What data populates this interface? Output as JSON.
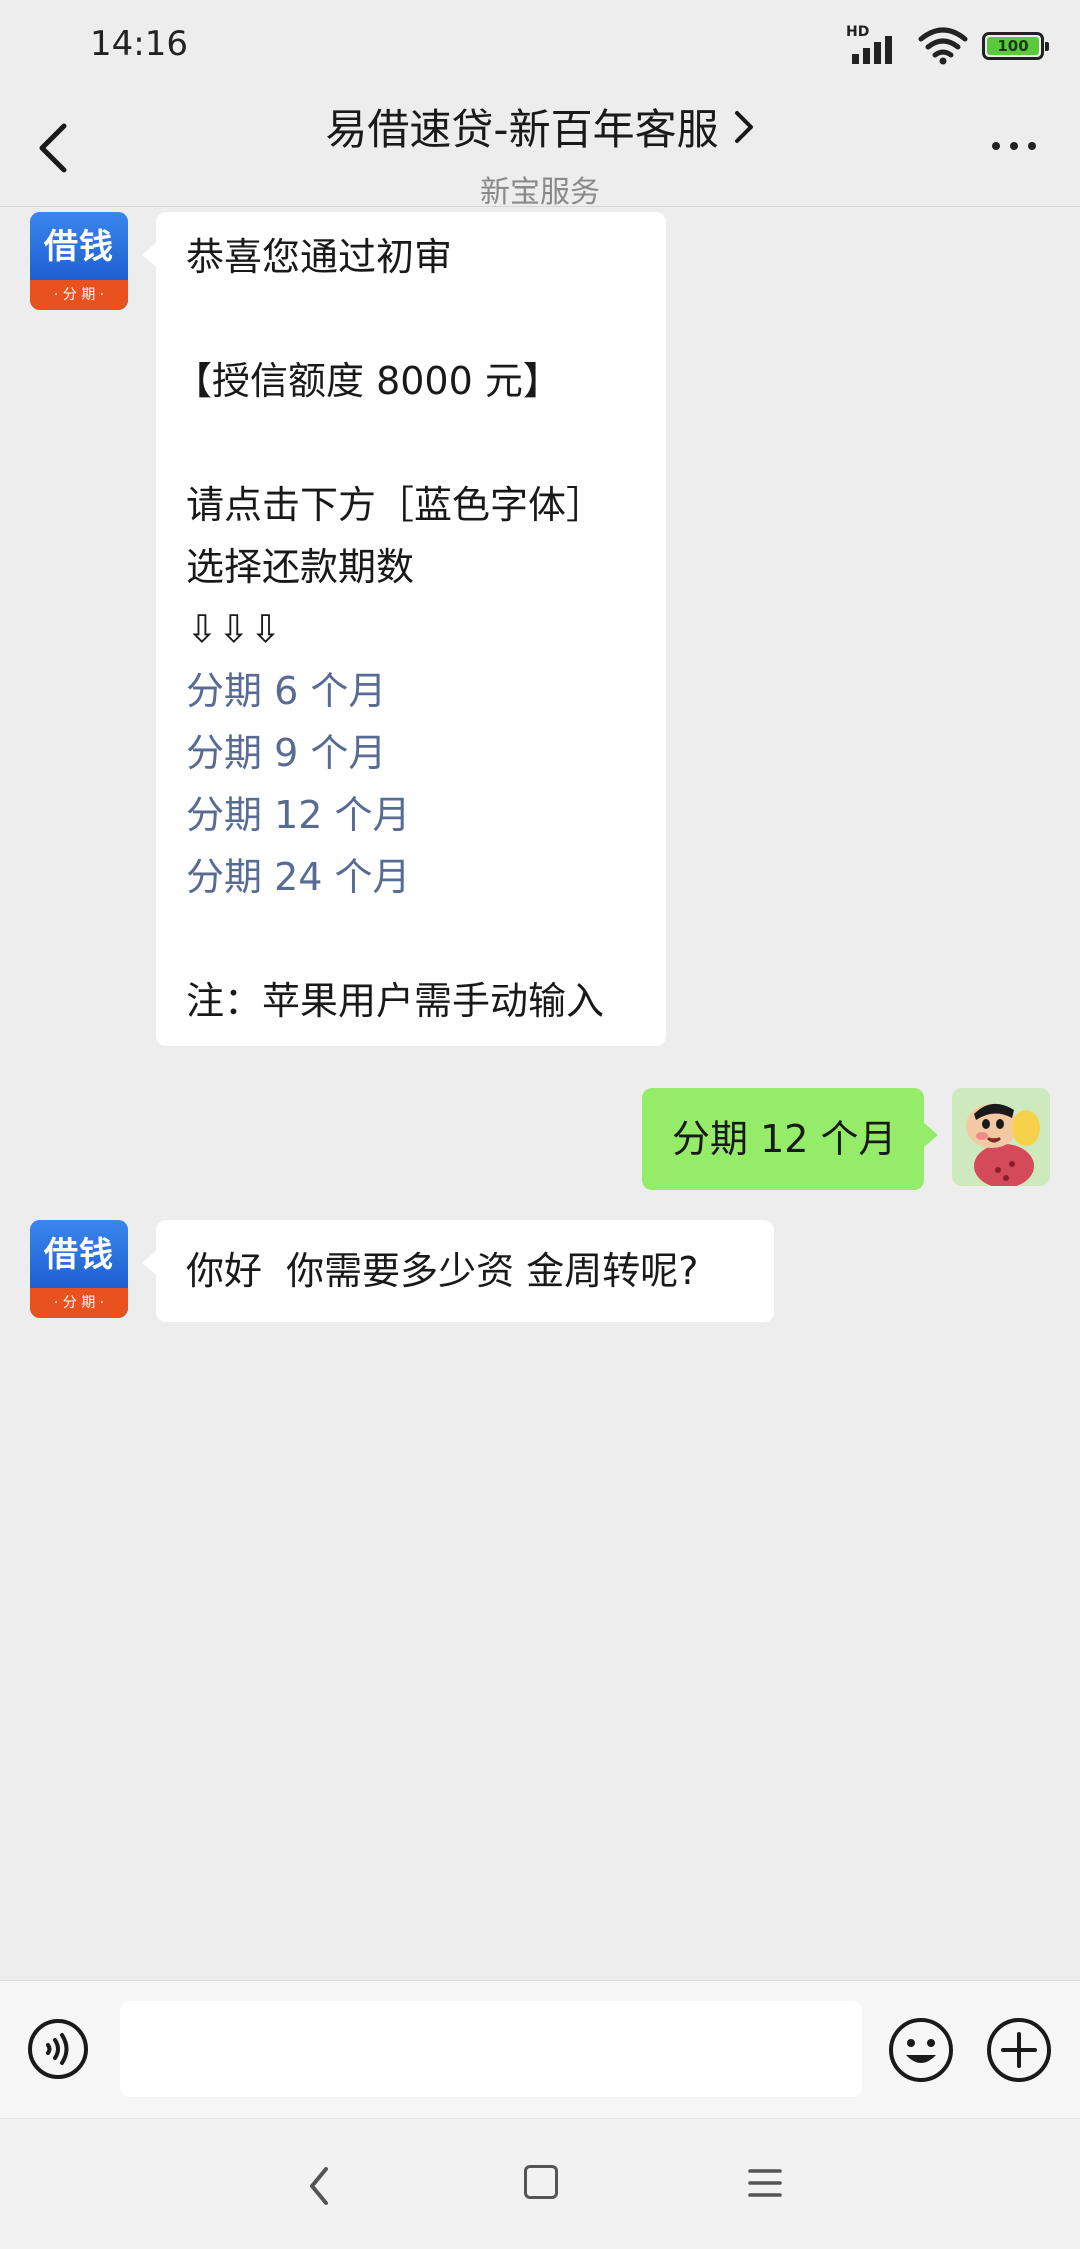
{
  "status_bar": {
    "time": "14:16",
    "network_label": "HD",
    "battery_level": "100",
    "icons": [
      "hd-signal-icon",
      "wifi-icon",
      "battery-icon"
    ]
  },
  "header": {
    "title": "易借速贷-新百年客服",
    "subtitle": "新宝服务",
    "icons": [
      "back-chevron-icon",
      "chevron-right-icon",
      "more-dots-icon"
    ]
  },
  "messages": [
    {
      "sender": "business",
      "avatar_text": "借钱",
      "avatar_subtext": "· 分 期 ·",
      "lines": [
        {
          "text": "恭喜您通过初审",
          "type": "text"
        },
        {
          "text": "",
          "type": "blank"
        },
        {
          "text": "【授信额度 8000 元】",
          "type": "text"
        },
        {
          "text": "",
          "type": "blank"
        },
        {
          "text": "请点击下方［蓝色字体］",
          "type": "text"
        },
        {
          "text": "选择还款期数",
          "type": "text"
        },
        {
          "text": " ⇩⇩⇩",
          "type": "text"
        },
        {
          "text": "分期 6 个月",
          "type": "link"
        },
        {
          "text": "分期 9 个月",
          "type": "link"
        },
        {
          "text": "分期 12 个月",
          "type": "link"
        },
        {
          "text": "分期 24 个月",
          "type": "link"
        },
        {
          "text": "",
          "type": "blank"
        },
        {
          "text": "注：苹果用户需手动输入",
          "type": "text"
        }
      ]
    },
    {
      "sender": "user",
      "text": "分期 12 个月"
    },
    {
      "sender": "business",
      "avatar_text": "借钱",
      "avatar_subtext": "· 分 期 ·",
      "text": "你好  你需要多少资 金周转呢?"
    }
  ],
  "input_bar": {
    "value": "",
    "icons": [
      "voice-icon",
      "emoji-icon",
      "plus-icon"
    ]
  },
  "system_nav": {
    "icons": [
      "nav-back-icon",
      "nav-home-icon",
      "nav-menu-icon"
    ]
  },
  "colors": {
    "background": "#ededed",
    "bubble_incoming": "#ffffff",
    "bubble_outgoing": "#95ec69",
    "link": "#576b95",
    "avatar_blue": "#2f6fe0",
    "avatar_orange": "#e8521f",
    "battery_green": "#5ac93b"
  }
}
